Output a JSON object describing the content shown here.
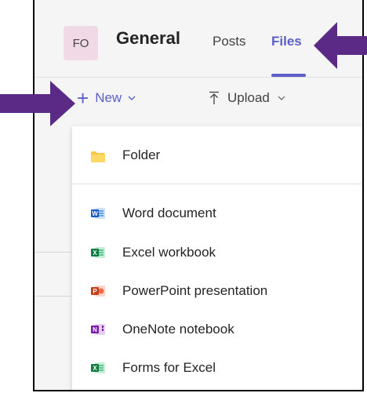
{
  "header": {
    "avatar_initials": "FO",
    "title": "General",
    "tabs": [
      {
        "label": "Posts",
        "active": false
      },
      {
        "label": "Files",
        "active": true
      }
    ]
  },
  "toolbar": {
    "new_label": "New",
    "upload_label": "Upload"
  },
  "menu": {
    "items": [
      {
        "label": "Folder",
        "icon": "folder-icon"
      },
      {
        "label": "Word document",
        "icon": "word-icon"
      },
      {
        "label": "Excel workbook",
        "icon": "excel-icon"
      },
      {
        "label": "PowerPoint presentation",
        "icon": "powerpoint-icon"
      },
      {
        "label": "OneNote notebook",
        "icon": "onenote-icon"
      },
      {
        "label": "Forms for Excel",
        "icon": "forms-excel-icon"
      }
    ]
  },
  "colors": {
    "accent": "#5b5fc7",
    "annotation_arrow": "#5b2a86",
    "avatar_bg": "#f2d9e6"
  }
}
